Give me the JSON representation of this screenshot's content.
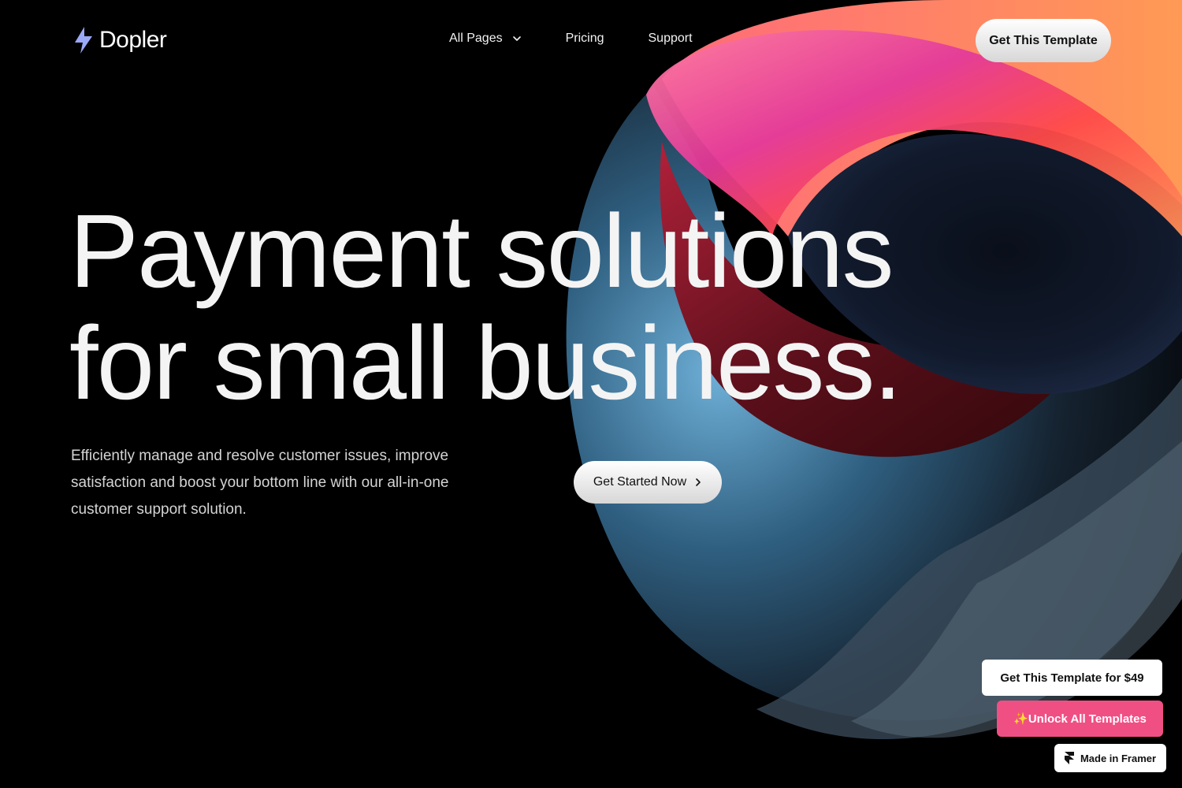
{
  "brand": {
    "name": "Dopler",
    "logo_icon": "lightning-bolt-icon",
    "accent": "#9aa8f5"
  },
  "nav": {
    "items": [
      {
        "label": "All Pages",
        "icon": "chevron-down-icon"
      },
      {
        "label": "Pricing"
      },
      {
        "label": "Support"
      }
    ],
    "cta_label": "Get This Template"
  },
  "hero": {
    "headline_line1": "Payment solutions",
    "headline_line2": "for small business.",
    "subtext": "Efficiently manage and resolve customer issues, improve satisfaction and boost your bottom line with our all-in-one customer support solution.",
    "cta_label": "Get Started Now",
    "cta_icon": "chevron-right-icon"
  },
  "badges": {
    "price_label": "Get This Template for $49",
    "unlock_label": "✨Unlock All Templates",
    "unlock_color": "#f04f84",
    "framer_label": "Made in Framer",
    "framer_icon": "framer-logo-icon"
  }
}
